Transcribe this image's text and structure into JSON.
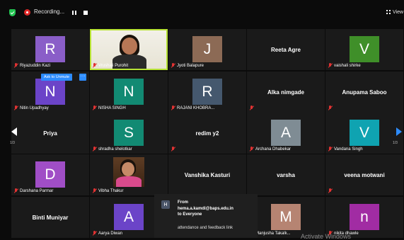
{
  "topbar": {
    "recording_label": "Recording...",
    "view_label": "View"
  },
  "pagination": {
    "left": "1/3",
    "right": "1/3"
  },
  "unmute_tip": "Ask to Unmute",
  "more_label": "···",
  "colors": {
    "tile_bg": "#1a1a1a",
    "active_border": "#b8e336",
    "accent_blue": "#2d8cff",
    "recording_red": "#e02828"
  },
  "tiles": [
    {
      "name": "Riyazuddin Kazi",
      "initial": "R",
      "color": "#8a5ec8",
      "muted": true
    },
    {
      "name": "Vrushali Purohit",
      "video": true,
      "active": true,
      "muted": true
    },
    {
      "name": "Jyoti Balapure",
      "initial": "J",
      "color": "#8c6a55",
      "muted": true
    },
    {
      "name": "",
      "title": "Reeta Agre",
      "muted": false
    },
    {
      "name": "vaishali shirke",
      "initial": "V",
      "color": "#3f8f29",
      "muted": true
    },
    {
      "name": "Nitin Upadhyay",
      "initial": "N",
      "color": "#6b44c8",
      "muted": true
    },
    {
      "name": "NISHA SINGH",
      "initial": "N",
      "color": "#128a73",
      "muted": true
    },
    {
      "name": "RAJANI KHOBRA...",
      "initial": "R",
      "color": "#45586e",
      "muted": true
    },
    {
      "name": "",
      "title": "Alka nimgade",
      "muted": true
    },
    {
      "name": "",
      "title": "Anupama Saboo",
      "muted": true
    },
    {
      "name": "",
      "title": "Priya",
      "muted": false
    },
    {
      "name": "shradha shelotkar",
      "initial": "S",
      "color": "#128a73",
      "muted": true
    },
    {
      "name": "",
      "title": "redim y2",
      "muted": true
    },
    {
      "name": "Archana Dhabekar",
      "initial": "A",
      "color": "#7f8c94",
      "muted": true
    },
    {
      "name": "Vandana Singh",
      "initial": "V",
      "color": "#0fa3b1",
      "muted": true
    },
    {
      "name": "Darshana Parmar",
      "initial": "D",
      "color": "#a04ec6",
      "muted": true
    },
    {
      "name": "Vibha Thakur",
      "video": true,
      "muted": true
    },
    {
      "name": "",
      "title": "Vanshika Kasturi",
      "muted": false
    },
    {
      "name": "",
      "title": "varsha",
      "muted": false
    },
    {
      "name": "",
      "title": "veena motwani",
      "muted": true
    },
    {
      "name": "",
      "title": "Binti Muniyar",
      "muted": false
    },
    {
      "name": "Aarya Diwan",
      "initial": "A",
      "color": "#6b44c8",
      "muted": true
    },
    {
      "name": "",
      "title": "",
      "muted": false
    },
    {
      "name": "Manjusha Takalk...",
      "initial": "M",
      "color": "#b68472",
      "muted": true
    },
    {
      "name": "nikita dhawle",
      "initial": "n",
      "color": "#a12ca3",
      "muted": true
    }
  ],
  "chat": {
    "avatar_initial": "H",
    "from_label": "From",
    "sender": "hema.a.kamdi@baps.edu.in",
    "to_label": "to Everyone",
    "message": "attendance and feedback link"
  },
  "watermark": "Activate Windows"
}
